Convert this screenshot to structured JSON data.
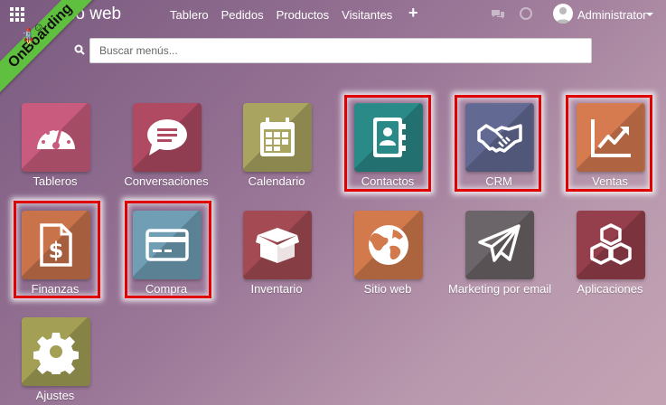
{
  "header": {
    "brand": "Sitio web",
    "nav": [
      "Tablero",
      "Pedidos",
      "Productos",
      "Visitantes"
    ],
    "plus": "+",
    "user": "Administrator"
  },
  "ribbon": {
    "text": "OnBoarding"
  },
  "search": {
    "placeholder": "Buscar menús..."
  },
  "apps": [
    {
      "label": "Tableros",
      "color": "#c95c7e",
      "icon": "dashboard-gauge-icon"
    },
    {
      "label": "Conversaciones",
      "color": "#b04a63",
      "icon": "chat-bubble-icon"
    },
    {
      "label": "Calendario",
      "color": "#a9a560",
      "icon": "calendar-icon"
    },
    {
      "label": "Contactos",
      "color": "#2a8a88",
      "icon": "address-book-icon"
    },
    {
      "label": "CRM",
      "color": "#626a93",
      "icon": "handshake-icon"
    },
    {
      "label": "Ventas",
      "color": "#d67a4f",
      "icon": "trend-chart-icon"
    },
    {
      "label": "Finanzas",
      "color": "#c9734b",
      "icon": "invoice-dollar-icon"
    },
    {
      "label": "Compra",
      "color": "#6f9eb5",
      "icon": "credit-card-icon"
    },
    {
      "label": "Inventario",
      "color": "#a34a52",
      "icon": "box-icon"
    },
    {
      "label": "Sitio web",
      "color": "#d27a4c",
      "icon": "globe-icon"
    },
    {
      "label": "Marketing por email",
      "color": "#6b6468",
      "icon": "paper-plane-icon"
    },
    {
      "label": "Aplicaciones",
      "color": "#963f4c",
      "icon": "cubes-icon"
    },
    {
      "label": "Ajustes",
      "color": "#a3a056",
      "icon": "gear-icon"
    }
  ],
  "colors": {
    "highlight": "#e00000",
    "ribbon": "#5fbf3e"
  }
}
